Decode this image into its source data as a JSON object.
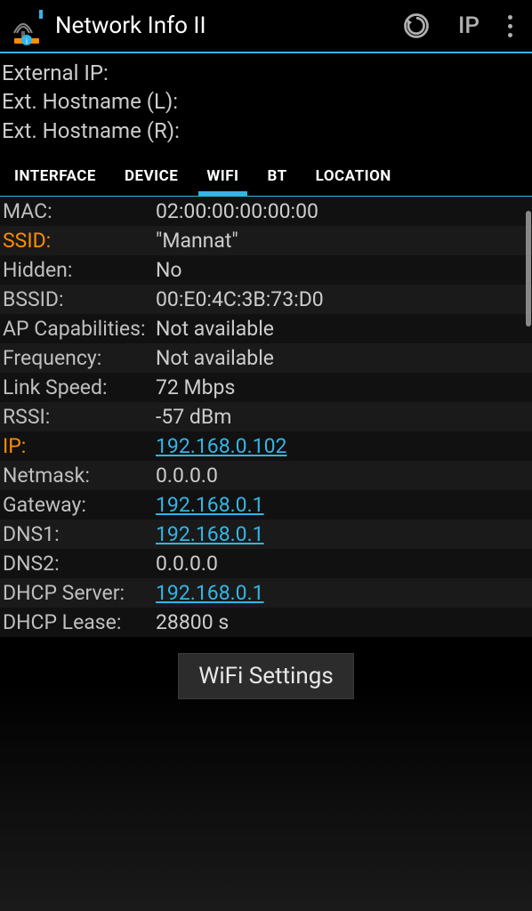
{
  "header": {
    "title": "Network Info II",
    "ip_label": "IP"
  },
  "ext": {
    "ip_label": "External IP:",
    "hostname_l_label": "Ext. Hostname (L):",
    "hostname_r_label": "Ext. Hostname (R):"
  },
  "tabs": [
    {
      "label": "INTERFACE",
      "active": false
    },
    {
      "label": "DEVICE",
      "active": false
    },
    {
      "label": "WIFI",
      "active": true
    },
    {
      "label": "BT",
      "active": false
    },
    {
      "label": "LOCATION",
      "active": false
    }
  ],
  "wifi": {
    "rows": [
      {
        "label": "MAC:",
        "value": "02:00:00:00:00:00",
        "highlight": false,
        "link": false
      },
      {
        "label": "SSID:",
        "value": "\"Mannat\"",
        "highlight": true,
        "link": false
      },
      {
        "label": "Hidden:",
        "value": "No",
        "highlight": false,
        "link": false
      },
      {
        "label": "BSSID:",
        "value": "00:E0:4C:3B:73:D0",
        "highlight": false,
        "link": false
      },
      {
        "label": "AP Capabilities:",
        "value": "Not available",
        "highlight": false,
        "link": false
      },
      {
        "label": "Frequency:",
        "value": "Not available",
        "highlight": false,
        "link": false
      },
      {
        "label": "Link Speed:",
        "value": "72 Mbps",
        "highlight": false,
        "link": false
      },
      {
        "label": "RSSI:",
        "value": "-57 dBm",
        "highlight": false,
        "link": false
      },
      {
        "label": "IP:",
        "value": "192.168.0.102",
        "highlight": true,
        "link": true
      },
      {
        "label": "Netmask:",
        "value": "0.0.0.0",
        "highlight": false,
        "link": false
      },
      {
        "label": "Gateway:",
        "value": "192.168.0.1",
        "highlight": false,
        "link": true
      },
      {
        "label": "DNS1:",
        "value": "192.168.0.1",
        "highlight": false,
        "link": true
      },
      {
        "label": "DNS2:",
        "value": "0.0.0.0",
        "highlight": false,
        "link": false
      },
      {
        "label": "DHCP Server:",
        "value": "192.168.0.1",
        "highlight": false,
        "link": true
      },
      {
        "label": "DHCP Lease:",
        "value": "28800 s",
        "highlight": false,
        "link": false
      }
    ]
  },
  "buttons": {
    "wifi_settings": "WiFi Settings"
  }
}
